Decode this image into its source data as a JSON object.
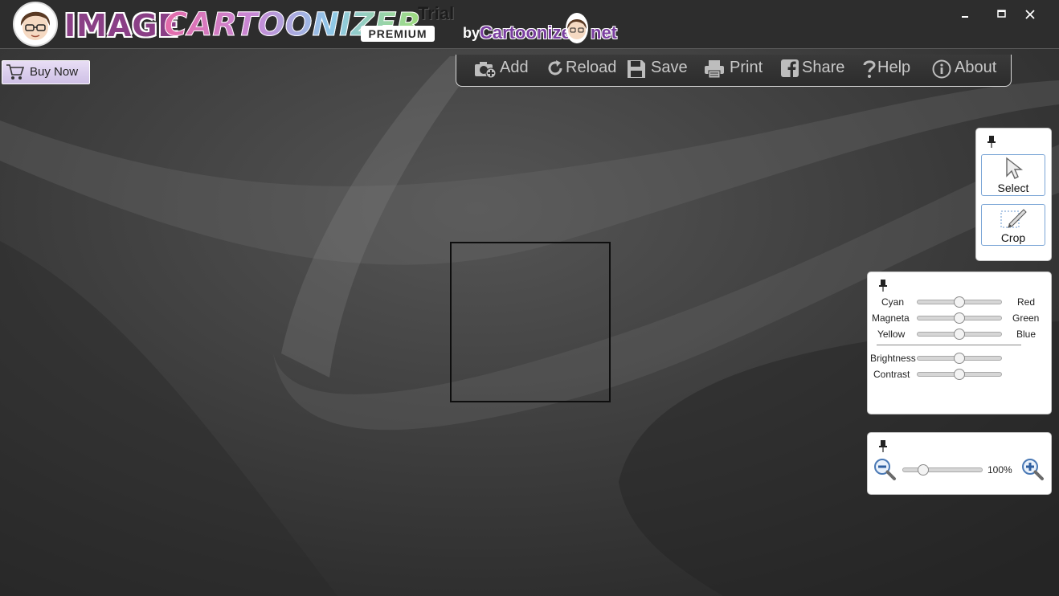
{
  "app": {
    "logo_image": "IMAGE",
    "logo_cartoonizer": "CARTOONIZER",
    "logo_premium": "PREMIUM",
    "trial": "Trial",
    "by": "by",
    "brand_name": "Cartoonize",
    "brand_suffix": "net"
  },
  "window_controls": {
    "minimize": "▬",
    "maximize": "■",
    "close": "✕"
  },
  "buy_now": {
    "label": "Buy Now",
    "icon": "cart-icon"
  },
  "toolbar": [
    {
      "name": "add",
      "label": "Add",
      "icon": "camera-add-icon"
    },
    {
      "name": "reload",
      "label": "Reload",
      "icon": "reload-icon"
    },
    {
      "name": "save",
      "label": "Save",
      "icon": "floppy-icon"
    },
    {
      "name": "print",
      "label": "Print",
      "icon": "printer-icon"
    },
    {
      "name": "share",
      "label": "Share",
      "icon": "facebook-icon"
    },
    {
      "name": "help",
      "label": "Help",
      "icon": "question-icon"
    },
    {
      "name": "about",
      "label": "About",
      "icon": "info-icon"
    }
  ],
  "tools_panel": {
    "select": "Select",
    "crop": "Crop"
  },
  "color_panel": {
    "color_balance": [
      {
        "left": "Cyan",
        "right": "Red",
        "value": 0.5
      },
      {
        "left": "Magneta",
        "right": "Green",
        "value": 0.5
      },
      {
        "left": "Yellow",
        "right": "Blue",
        "value": 0.5
      }
    ],
    "adjustments": [
      {
        "label": "Brightness",
        "value": 0.5
      },
      {
        "label": "Contrast",
        "value": 0.5
      }
    ]
  },
  "zoom_panel": {
    "value": "100%",
    "slider_value": 0.25
  },
  "colors": {
    "accent_purple": "#8a3f86",
    "toolbar_text": "#c8c8c8",
    "tool_button_border": "#7aa5d6"
  }
}
